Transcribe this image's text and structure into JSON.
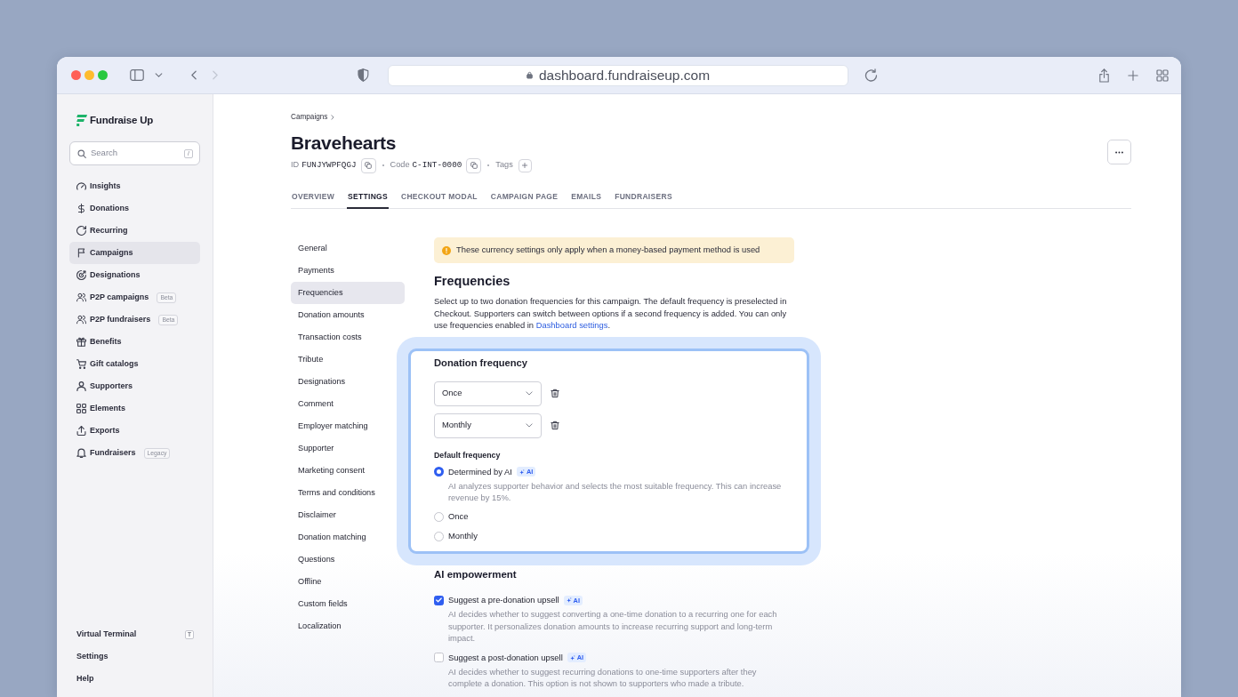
{
  "browser": {
    "url": "dashboard.fundraiseup.com",
    "forward_enabled": false
  },
  "sidebar": {
    "logo": "Fundraise Up",
    "search": {
      "placeholder": "Search",
      "shortcut": "/"
    },
    "items": [
      {
        "label": "Insights",
        "selected": false
      },
      {
        "label": "Donations",
        "selected": false
      },
      {
        "label": "Recurring",
        "selected": false
      },
      {
        "label": "Campaigns",
        "selected": true
      },
      {
        "label": "Designations",
        "selected": false
      },
      {
        "label": "P2P campaigns",
        "selected": false,
        "badge": "Beta"
      },
      {
        "label": "P2P fundraisers",
        "selected": false,
        "badge": "Beta"
      },
      {
        "label": "Benefits",
        "selected": false
      },
      {
        "label": "Gift catalogs",
        "selected": false
      },
      {
        "label": "Supporters",
        "selected": false
      },
      {
        "label": "Elements",
        "selected": false
      },
      {
        "label": "Exports",
        "selected": false
      },
      {
        "label": "Fundraisers",
        "selected": false,
        "badge": "Legacy"
      }
    ],
    "footer_items": [
      {
        "label": "Virtual Terminal",
        "shortcut": "T"
      },
      {
        "label": "Settings"
      },
      {
        "label": "Help"
      }
    ]
  },
  "breadcrumb": [
    {
      "label": "Campaigns"
    }
  ],
  "campaign": {
    "title": "Bravehearts",
    "id_label": "ID",
    "id": "FUNJYWPFQGJ",
    "code_label": "Code",
    "code": "C-INT-0000",
    "tags_label": "Tags"
  },
  "tabs": [
    {
      "label": "OVERVIEW",
      "selected": false
    },
    {
      "label": "SETTINGS",
      "selected": true
    },
    {
      "label": "CHECKOUT MODAL",
      "selected": false
    },
    {
      "label": "CAMPAIGN PAGE",
      "selected": false
    },
    {
      "label": "EMAILS",
      "selected": false
    },
    {
      "label": "FUNDRAISERS",
      "selected": false
    }
  ],
  "settings_nav": [
    {
      "label": "General",
      "selected": false
    },
    {
      "label": "Payments",
      "selected": false
    },
    {
      "label": "Frequencies",
      "selected": true
    },
    {
      "label": "Donation amounts",
      "selected": false
    },
    {
      "label": "Transaction costs",
      "selected": false
    },
    {
      "label": "Tribute",
      "selected": false
    },
    {
      "label": "Designations",
      "selected": false
    },
    {
      "label": "Comment",
      "selected": false
    },
    {
      "label": "Employer matching",
      "selected": false
    },
    {
      "label": "Supporter",
      "selected": false
    },
    {
      "label": "Marketing consent",
      "selected": false
    },
    {
      "label": "Terms and conditions",
      "selected": false
    },
    {
      "label": "Disclaimer",
      "selected": false
    },
    {
      "label": "Donation matching",
      "selected": false
    },
    {
      "label": "Questions",
      "selected": false
    },
    {
      "label": "Offline",
      "selected": false
    },
    {
      "label": "Custom fields",
      "selected": false
    },
    {
      "label": "Localization",
      "selected": false
    }
  ],
  "alert": {
    "text": "These currency settings only apply when a money-based payment method is used"
  },
  "frequencies": {
    "title": "Frequencies",
    "description": "Select up to two donation frequencies for this campaign. The default frequency is preselected in Checkout. Supporters can switch between options if a second frequency is added. You can only use frequencies enabled in",
    "link": "Dashboard settings",
    "description_end": "."
  },
  "donation_frequency": {
    "highlighted": true,
    "title": "Donation frequency",
    "selects": [
      {
        "value": "Once"
      },
      {
        "value": "Monthly"
      }
    ],
    "default_label": "Default frequency",
    "options": [
      {
        "label": "Determined by AI",
        "badge": "AI",
        "selected": true,
        "description": "AI analyzes supporter behavior and selects the most suitable frequency. This can increase revenue by 15%."
      },
      {
        "label": "Once",
        "selected": false
      },
      {
        "label": "Monthly",
        "selected": false
      }
    ]
  },
  "ai_empowerment": {
    "title": "AI empowerment",
    "options": [
      {
        "label": "Suggest a pre-donation upsell",
        "badge": "AI",
        "checked": true,
        "description": "AI decides whether to suggest converting a one-time donation to a recurring one for each supporter. It personalizes donation amounts to increase recurring support and long-term impact."
      },
      {
        "label": "Suggest a post-donation upsell",
        "badge": "AI",
        "checked": false,
        "description": "AI decides whether to suggest recurring donations to one-time supporters after they complete a donation. This option is not shown to supporters who made a tribute."
      }
    ]
  }
}
